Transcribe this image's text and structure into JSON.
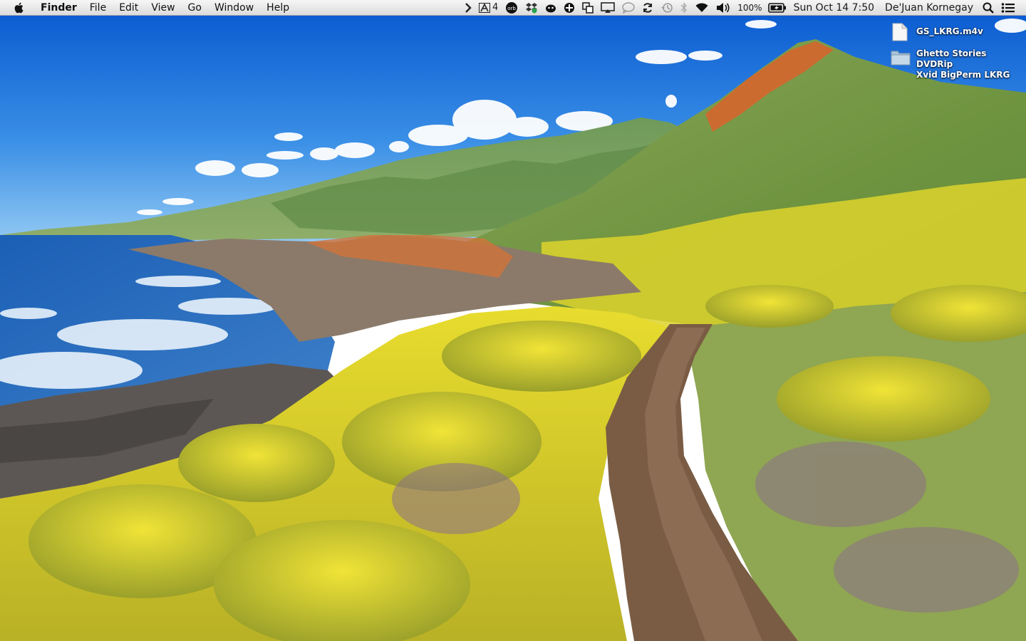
{
  "menubar": {
    "app_name": "Finder",
    "menus": [
      "File",
      "Edit",
      "View",
      "Go",
      "Window",
      "Help"
    ],
    "status": {
      "adobe_count": "4",
      "orb_label": "orb",
      "battery_percent": "100%",
      "datetime": "Sun Oct 14  7:50",
      "user_name": "De'Juan Kornegay"
    },
    "icons": [
      "apple-icon",
      "chevron-right-icon",
      "adobe-icon",
      "orb-icon",
      "dropbox-icon",
      "bug-icon",
      "gamepad-icon",
      "screen-mirror-icon",
      "airplay-icon",
      "messages-icon",
      "sync-icon",
      "time-machine-icon",
      "bluetooth-icon",
      "wifi-icon",
      "volume-icon",
      "battery-icon",
      "spotlight-icon",
      "notification-center-icon"
    ]
  },
  "desktop": {
    "items": [
      {
        "name": "GS_LKRG.m4v",
        "kind": "file"
      },
      {
        "name_line1": "Ghetto Stories DVDRip",
        "name_line2": "Xvid BigPerm LKRG",
        "kind": "folder"
      }
    ]
  },
  "colors": {
    "sky_top": "#0a5fd6",
    "sky_bottom": "#7bc0f2",
    "ocean": "#1e63b8",
    "hill_green": "#7d9a4a",
    "flowers_yellow": "#e5d92a",
    "trail": "#7a5c44",
    "orange_moss": "#e0662a"
  }
}
